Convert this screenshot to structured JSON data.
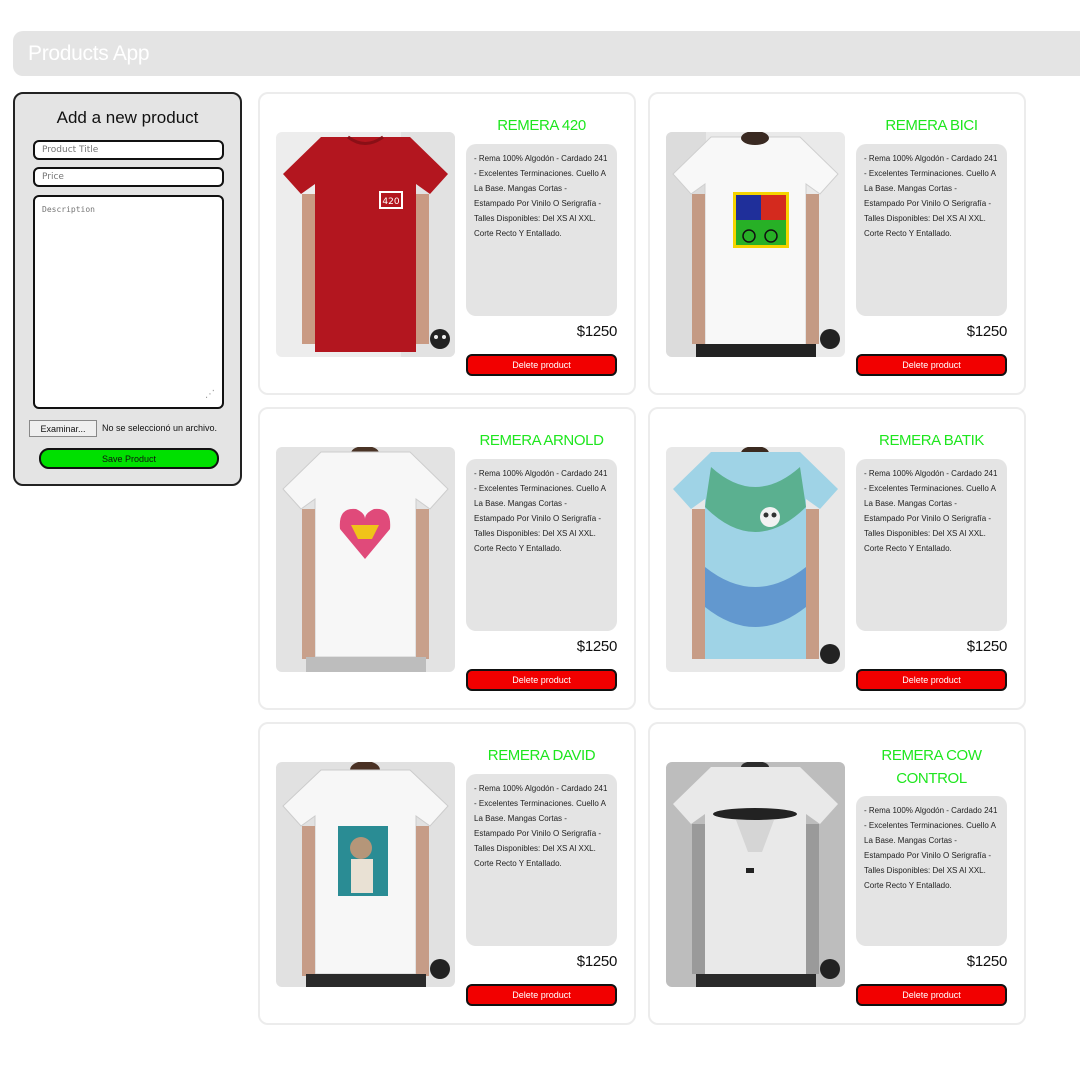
{
  "header": {
    "title": "Products App"
  },
  "form": {
    "heading": "Add a new product",
    "title_placeholder": "Product Title",
    "price_placeholder": "Price",
    "description_placeholder": "Description",
    "file_button_label": "Examinar...",
    "file_status": "No se seleccionó un archivo.",
    "save_label": "Save Product"
  },
  "products": [
    {
      "title": "REMERA 420",
      "description": "- Rema 100% Algodón - Cardado 241 - Excelentes Terminaciones. Cuello A La Base. Mangas Cortas - Estampado Por Vinilo O Serigrafía - Talles Disponibles: Del XS Al XXL. Corte Recto Y Entallado.",
      "price": "$1250",
      "delete_label": "Delete product",
      "shirt_color": "#b3161f",
      "print": "small-logo"
    },
    {
      "title": "REMERA BICI",
      "description": "- Rema 100% Algodón - Cardado 241 - Excelentes Terminaciones. Cuello A La Base. Mangas Cortas - Estampado Por Vinilo O Serigrafía - Talles Disponibles: Del XS Al XXL. Corte Recto Y Entallado.",
      "price": "$1250",
      "delete_label": "Delete product",
      "shirt_color": "#f2f2f2",
      "print": "bici"
    },
    {
      "title": "REMERA ARNOLD",
      "description": "- Rema 100% Algodón - Cardado 241 - Excelentes Terminaciones. Cuello A La Base. Mangas Cortas - Estampado Por Vinilo O Serigrafía - Talles Disponibles: Del XS Al XXL. Corte Recto Y Entallado.",
      "price": "$1250",
      "delete_label": "Delete product",
      "shirt_color": "#f4f4f4",
      "print": "heart"
    },
    {
      "title": "REMERA BATIK",
      "description": "- Rema 100% Algodón - Cardado 241 - Excelentes Terminaciones. Cuello A La Base. Mangas Cortas - Estampado Por Vinilo O Serigrafía - Talles Disponibles: Del XS Al XXL. Corte Recto Y Entallado.",
      "price": "$1250",
      "delete_label": "Delete product",
      "shirt_color": "#9fd3e6",
      "print": "batik"
    },
    {
      "title": "REMERA DAVID",
      "description": "- Rema 100% Algodón - Cardado 241 - Excelentes Terminaciones. Cuello A La Base. Mangas Cortas - Estampado Por Vinilo O Serigrafía - Talles Disponibles: Del XS Al XXL. Corte Recto Y Entallado.",
      "price": "$1250",
      "delete_label": "Delete product",
      "shirt_color": "#f4f4f4",
      "print": "david"
    },
    {
      "title": "REMERA COW CONTROL",
      "description": "- Rema 100% Algodón - Cardado 241 - Excelentes Terminaciones. Cuello A La Base. Mangas Cortas - Estampado Por Vinilo O Serigrafía - Talles Disponibles: Del XS Al XXL. Corte Recto Y Entallado.",
      "price": "$1250",
      "delete_label": "Delete product",
      "shirt_color": "#e9e9e9",
      "print": "ufo"
    }
  ],
  "colors": {
    "accent_green": "#1ee61e",
    "save_green": "#00e000",
    "delete_red": "#f20000",
    "panel_gray": "#e4e4e4"
  }
}
